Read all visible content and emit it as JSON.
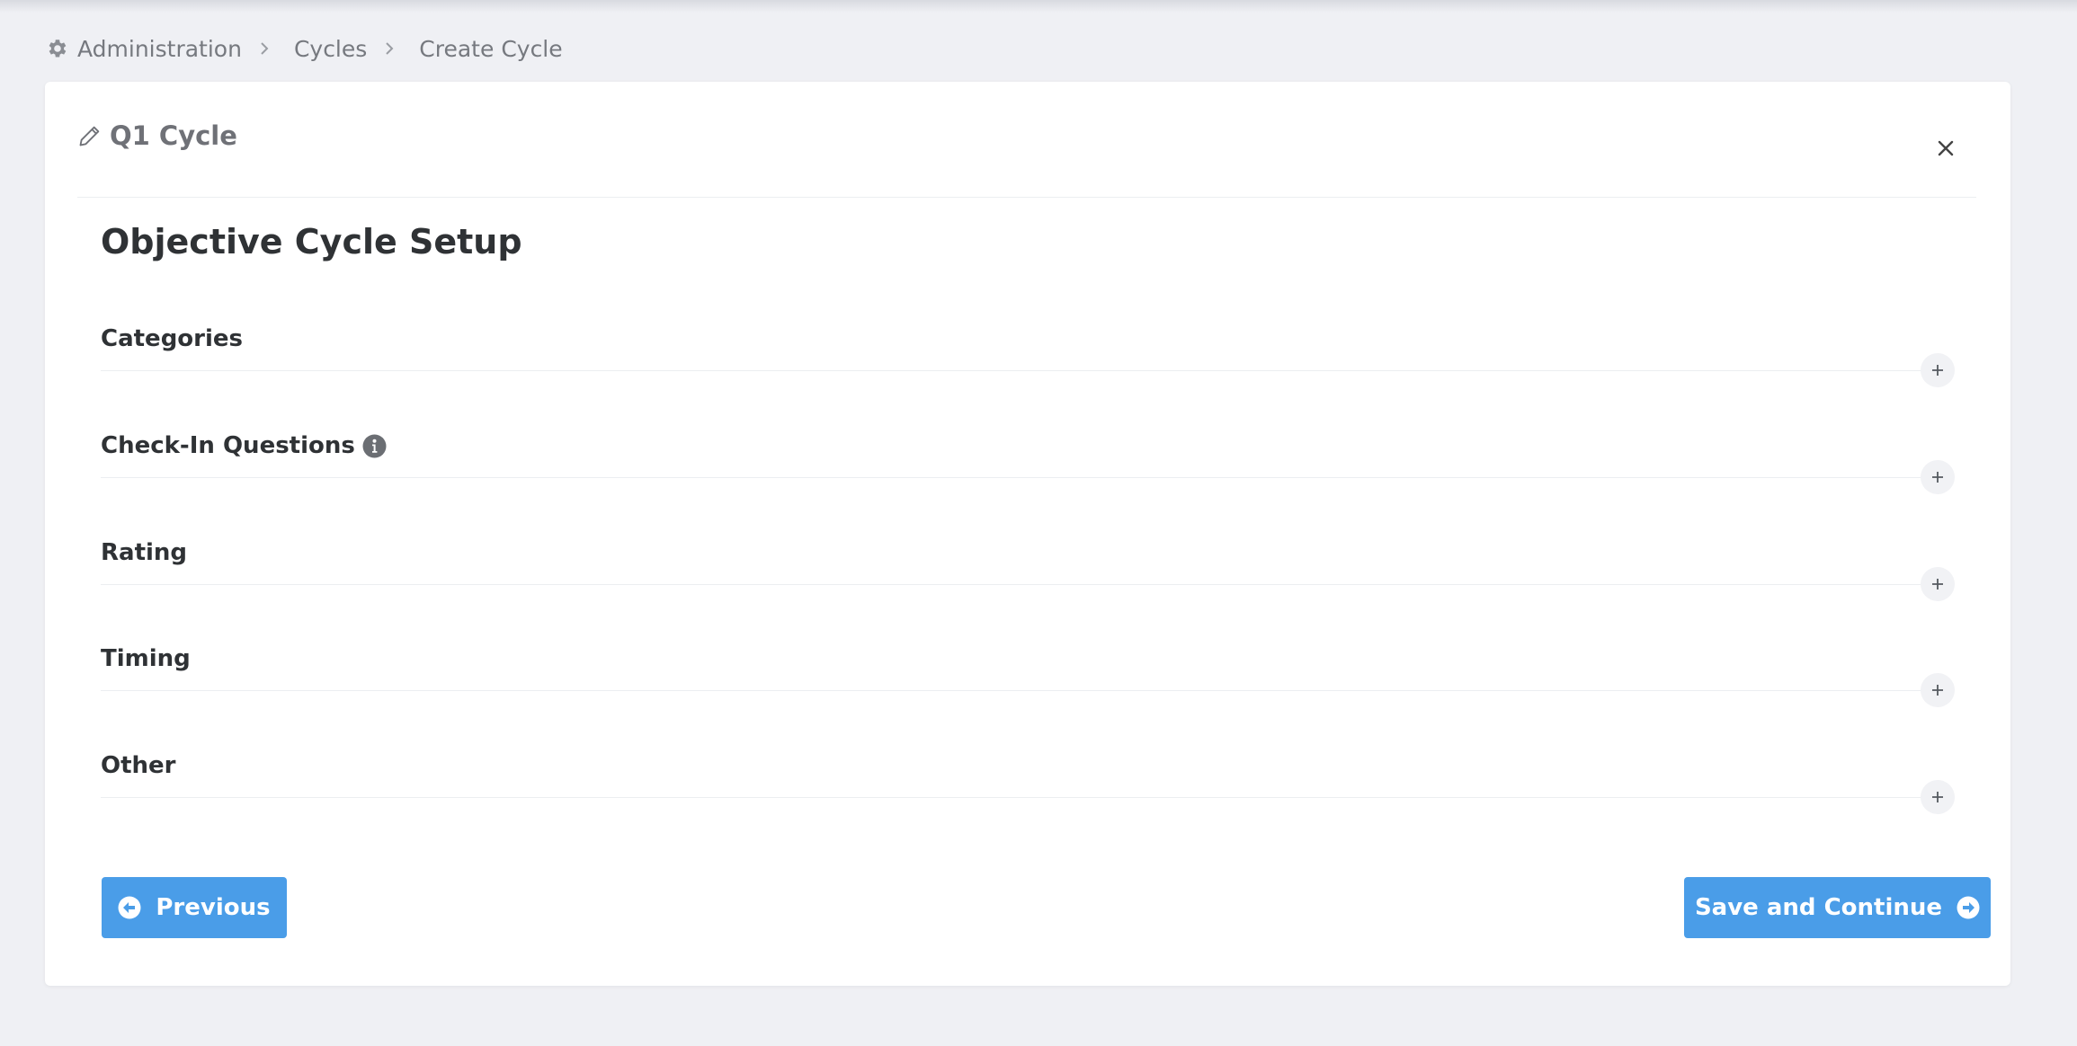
{
  "breadcrumb": {
    "icon": "gear-icon",
    "items": [
      "Administration",
      "Cycles",
      "Create Cycle"
    ]
  },
  "cycle": {
    "name": "Q1 Cycle",
    "edit_icon": "pencil-icon",
    "close_icon": "close-icon"
  },
  "section_title": "Objective Cycle Setup",
  "accordion": [
    {
      "label": "Categories",
      "has_info": false
    },
    {
      "label": "Check-In Questions",
      "has_info": true
    },
    {
      "label": "Rating",
      "has_info": false
    },
    {
      "label": "Timing",
      "has_info": false
    },
    {
      "label": "Other",
      "has_info": false
    }
  ],
  "buttons": {
    "previous": "Previous",
    "save_continue": "Save and Continue"
  },
  "colors": {
    "background": "#eff0f4",
    "card": "#ffffff",
    "primary": "#4a9de8",
    "heading": "#2f3235",
    "muted": "#76797f"
  }
}
